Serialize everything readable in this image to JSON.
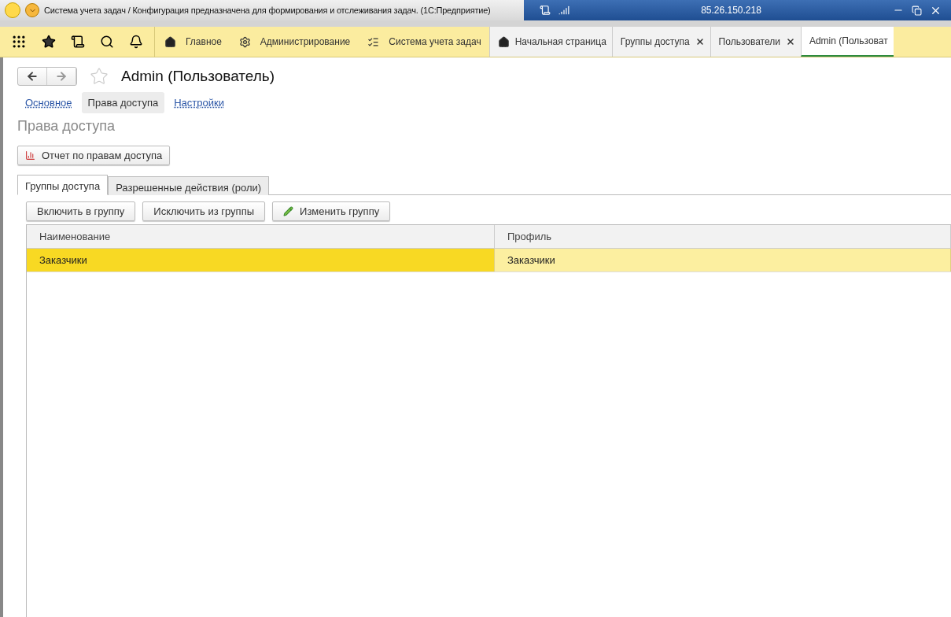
{
  "window": {
    "title": "Система учета задач / Конфигурация предназначена для формирования и отслеживания задач.  (1С:Предприятие)",
    "remote_host": "85.26.150.218"
  },
  "sections": [
    {
      "label": "Главное"
    },
    {
      "label": "Администрирование"
    },
    {
      "label": "Система учета задач"
    }
  ],
  "open_tabs": [
    {
      "label": "Начальная страница",
      "closable": false,
      "selected": false
    },
    {
      "label": "Группы доступа",
      "closable": true,
      "selected": false
    },
    {
      "label": "Пользователи",
      "closable": true,
      "selected": false
    },
    {
      "label": "Admin (Пользоват",
      "closable": false,
      "selected": true
    }
  ],
  "form": {
    "title": "Admin (Пользователь)",
    "links": [
      {
        "label": "Основное",
        "selected": false
      },
      {
        "label": "Права доступа",
        "selected": true
      },
      {
        "label": "Настройки",
        "selected": false
      }
    ],
    "heading": "Права доступа",
    "report_button": "Отчет по правам доступа",
    "tabs": [
      {
        "label": "Группы доступа",
        "selected": true
      },
      {
        "label": "Разрешенные действия (роли)",
        "selected": false
      }
    ],
    "buttons": [
      {
        "label": "Включить в группу"
      },
      {
        "label": "Исключить из группы"
      },
      {
        "label": "Изменить группу"
      }
    ],
    "table": {
      "columns": [
        "Наименование",
        "Профиль"
      ],
      "rows": [
        {
          "cells": [
            "Заказчики",
            "Заказчики"
          ],
          "selected": true
        }
      ]
    }
  }
}
